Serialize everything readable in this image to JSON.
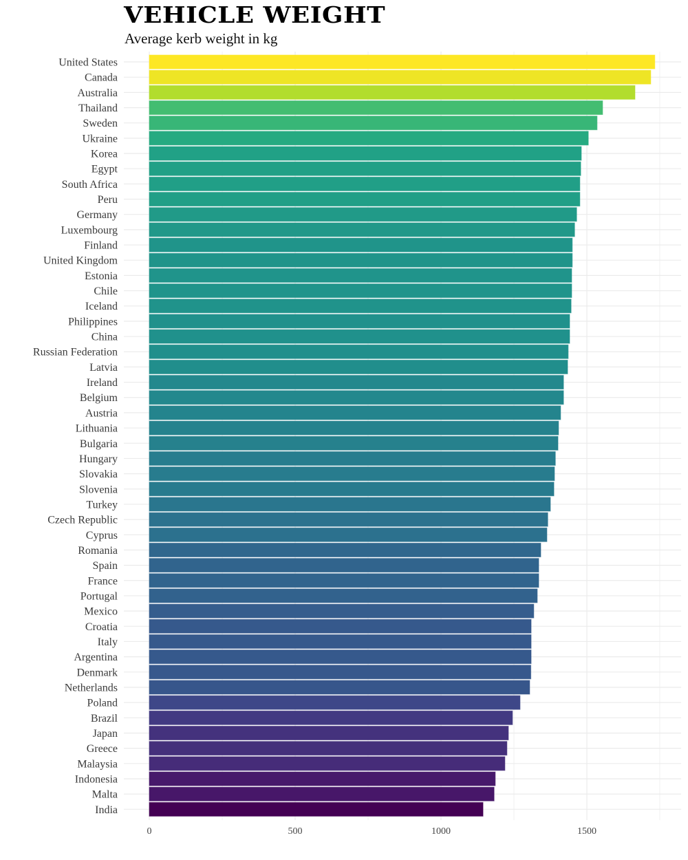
{
  "chart_data": {
    "type": "bar",
    "orientation": "horizontal",
    "title": "VEHICLE WEIGHT",
    "subtitle": "Average kerb weight in kg",
    "xlabel": "",
    "ylabel": "",
    "xlim": [
      0,
      1800
    ],
    "xticks": [
      0,
      500,
      1000,
      1500
    ],
    "xtick_labels": [
      "0",
      "500",
      "1000",
      "1500"
    ],
    "grid": true,
    "legend": "none",
    "color_scale": "viridis (by value)",
    "categories": [
      "United States",
      "Canada",
      "Australia",
      "Thailand",
      "Sweden",
      "Ukraine",
      "Korea",
      "Egypt",
      "South Africa",
      "Peru",
      "Germany",
      "Luxembourg",
      "Finland",
      "United Kingdom",
      "Estonia",
      "Chile",
      "Iceland",
      "Philippines",
      "China",
      "Russian Federation",
      "Latvia",
      "Ireland",
      "Belgium",
      "Austria",
      "Lithuania",
      "Bulgaria",
      "Hungary",
      "Slovakia",
      "Slovenia",
      "Turkey",
      "Czech Republic",
      "Cyprus",
      "Romania",
      "Spain",
      "France",
      "Portugal",
      "Mexico",
      "Croatia",
      "Italy",
      "Argentina",
      "Denmark",
      "Netherlands",
      "Poland",
      "Brazil",
      "Japan",
      "Greece",
      "Malaysia",
      "Indonesia",
      "Malta",
      "India"
    ],
    "values": [
      1733,
      1719,
      1665,
      1554,
      1535,
      1505,
      1481,
      1479,
      1476,
      1476,
      1465,
      1458,
      1450,
      1450,
      1448,
      1448,
      1446,
      1441,
      1441,
      1436,
      1434,
      1420,
      1420,
      1410,
      1403,
      1401,
      1392,
      1389,
      1387,
      1375,
      1366,
      1363,
      1342,
      1335,
      1335,
      1330,
      1318,
      1309,
      1309,
      1309,
      1308,
      1304,
      1271,
      1245,
      1231,
      1226,
      1219,
      1186,
      1182,
      1144
    ]
  }
}
